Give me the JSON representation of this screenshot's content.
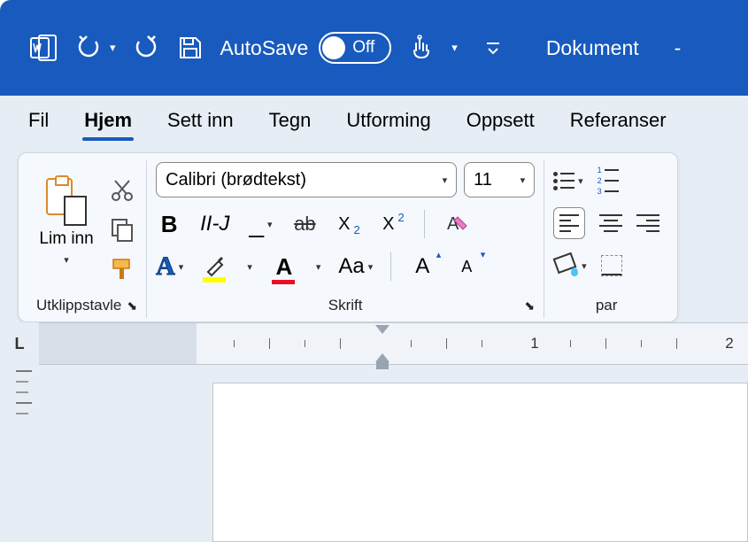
{
  "titlebar": {
    "autosave_label": "AutoSave",
    "autosave_state": "Off",
    "document_title": "Dokument",
    "dash": "-"
  },
  "tabs": {
    "fil": "Fil",
    "hjem": "Hjem",
    "sett_inn": "Sett inn",
    "tegn": "Tegn",
    "utforming": "Utforming",
    "oppsett": "Oppsett",
    "referanser": "Referanser"
  },
  "ribbon": {
    "clipboard": {
      "paste": "Lim inn",
      "group_label": "Utklippstavle"
    },
    "font": {
      "name": "Calibri (brødtekst)",
      "size": "11",
      "bold": "B",
      "italic": "II-J",
      "underline": "_",
      "strike": "ab",
      "sub_x": "X",
      "sub_n": "2",
      "sup_x": "X",
      "sup_n": "2",
      "texteff": "A",
      "fontcolor": "A",
      "changecase": "Aa",
      "grow": "A",
      "shrink": "A",
      "group_label": "Skrift"
    },
    "paragraph": {
      "group_label": "par"
    }
  },
  "ruler": {
    "corner": "L",
    "n1": "1",
    "n2": "2"
  }
}
